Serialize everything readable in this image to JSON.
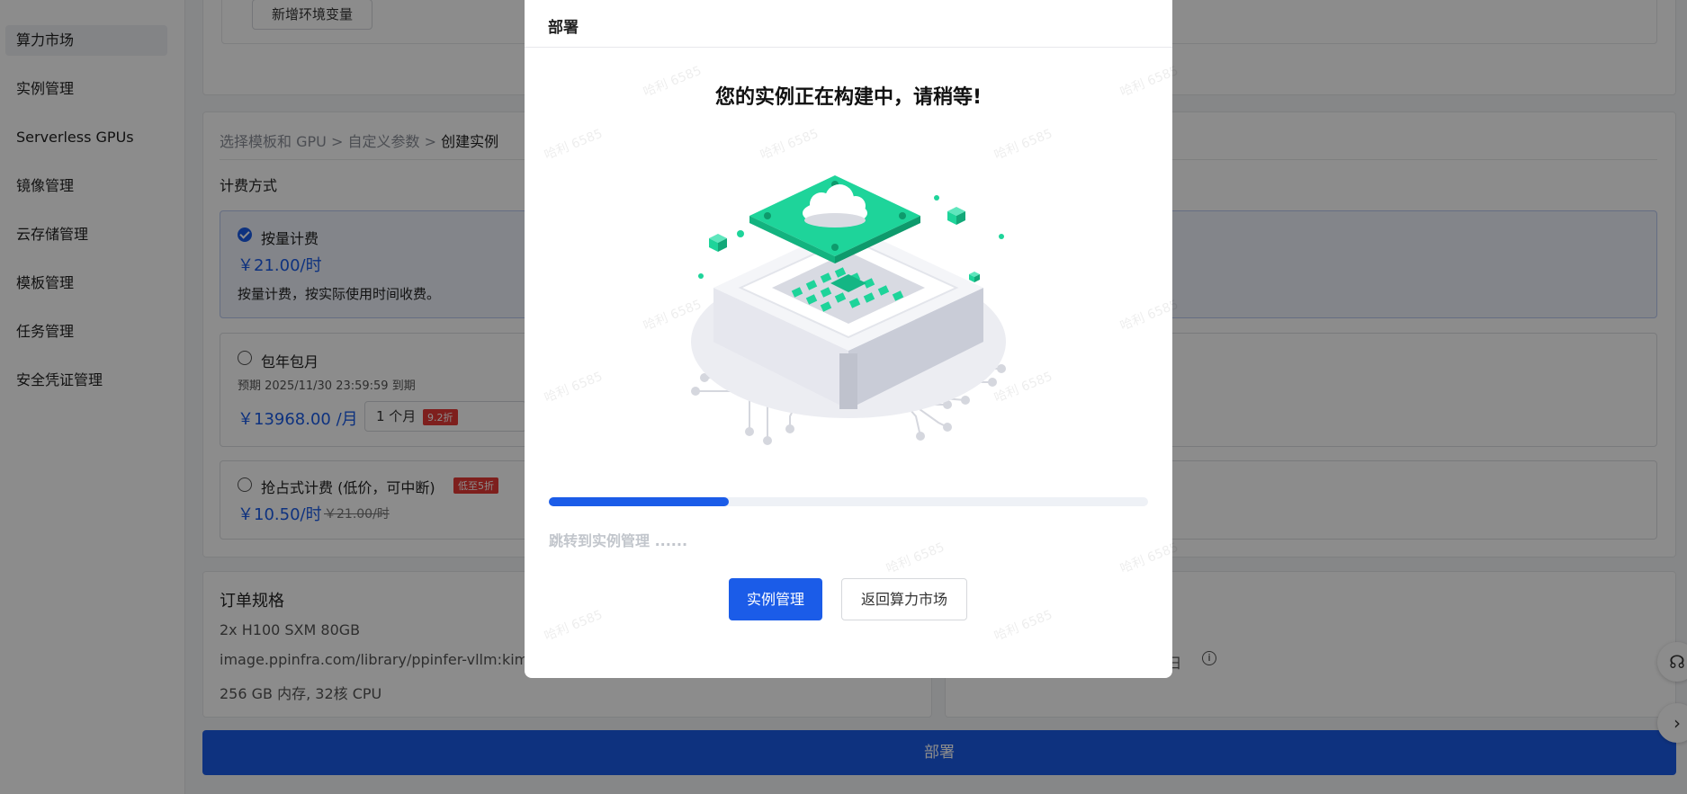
{
  "sidebar": {
    "items": [
      {
        "label": "算力市场"
      },
      {
        "label": "实例管理"
      },
      {
        "label": "Serverless GPUs"
      },
      {
        "label": "镜像管理"
      },
      {
        "label": "云存储管理"
      },
      {
        "label": "模板管理"
      },
      {
        "label": "任务管理"
      },
      {
        "label": "安全凭证管理"
      }
    ]
  },
  "env": {
    "add_label": "新增环境变量"
  },
  "breadcrumb": {
    "step1": "选择模板和 GPU",
    "step2": "自定义参数",
    "step3": "创建实例",
    "sep": ">"
  },
  "billing": {
    "section_label": "计费方式",
    "payg": {
      "label": "按量计费",
      "price": "￥21.00/时",
      "desc": "按量计费，按实际使用时间收费。"
    },
    "monthly": {
      "label": "包年包月",
      "expire": "预期  2025/11/30 23:59:59 到期",
      "price": "￥13968.00 /月",
      "period": "1 个月",
      "discount": "9.2折"
    },
    "spot": {
      "label": "抢占式计费 (低价，可中断)",
      "badge": "低至5折",
      "price": "￥10.50/时",
      "orig": "￥21.00/时"
    }
  },
  "order": {
    "title": "订单规格",
    "gpu": "2x H100 SXM 80GB",
    "image": "image.ppinfra.com/library/ppinfer-vllm:kimi-",
    "resources": "256 GB 内存, 32核 CPU",
    "right_suffix": "/日"
  },
  "deploy_button": "部署",
  "modal": {
    "title": "部署",
    "heading": "您的实例正在构建中，请稍等!",
    "progress": 0.3,
    "redirect_text": "跳转到实例管理 ......",
    "primary_button": "实例管理",
    "secondary_button": "返回算力市场",
    "watermark": "哈利 6585"
  },
  "colors": {
    "primary": "#1b5ce8",
    "accent_green": "#1ed49a"
  },
  "icons": {
    "support": "headset-icon",
    "expand": "chevron-right-icon",
    "info": "info-icon"
  }
}
